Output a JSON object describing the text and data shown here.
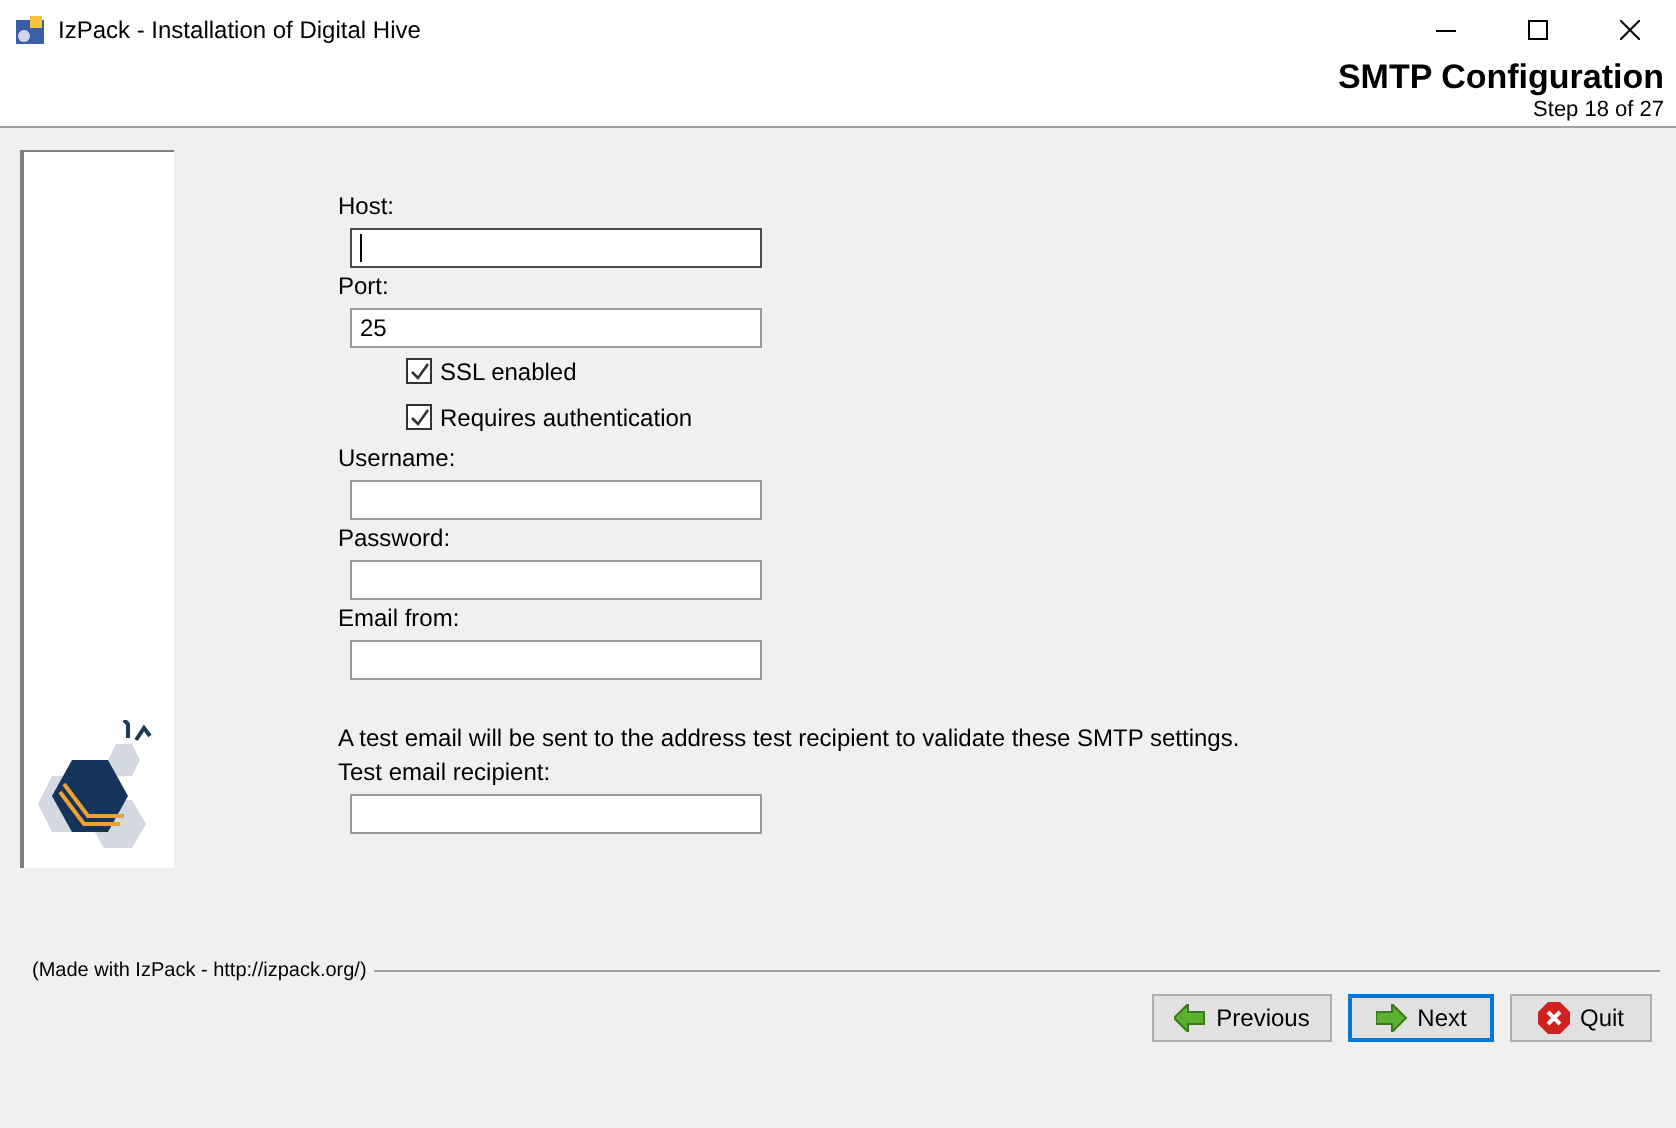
{
  "window": {
    "title": "IzPack - Installation of  Digital Hive"
  },
  "header": {
    "title": "SMTP Configuration",
    "step": "Step 18 of 27"
  },
  "form": [
    {
      "kind": "field",
      "label": "Host:",
      "focused": true
    },
    {
      "kind": "field",
      "label": "Port:",
      "value": "25",
      "focused": false
    },
    {
      "kind": "checkbox",
      "label": "SSL enabled",
      "checked": true
    },
    {
      "kind": "checkbox",
      "label": "Requires authentication",
      "checked": true
    },
    {
      "kind": "field",
      "label": "Username:",
      "focused": false
    },
    {
      "kind": "field",
      "label": "Password:",
      "focused": false
    },
    {
      "kind": "field",
      "label": "Email from:",
      "focused": false
    },
    {
      "kind": "note",
      "label": "A test email will be sent to the address test recipient to validate these SMTP settings."
    },
    {
      "kind": "field",
      "label": "Test email recipient:",
      "focused": false
    }
  ],
  "footer": {
    "credit": "(Made with IzPack - http://izpack.org/)"
  },
  "buttons": [
    {
      "kind": "previous",
      "label": "Previous",
      "focused": false
    },
    {
      "kind": "next",
      "label": "Next",
      "focused": true
    },
    {
      "kind": "quit",
      "label": "Quit",
      "focused": false
    }
  ]
}
